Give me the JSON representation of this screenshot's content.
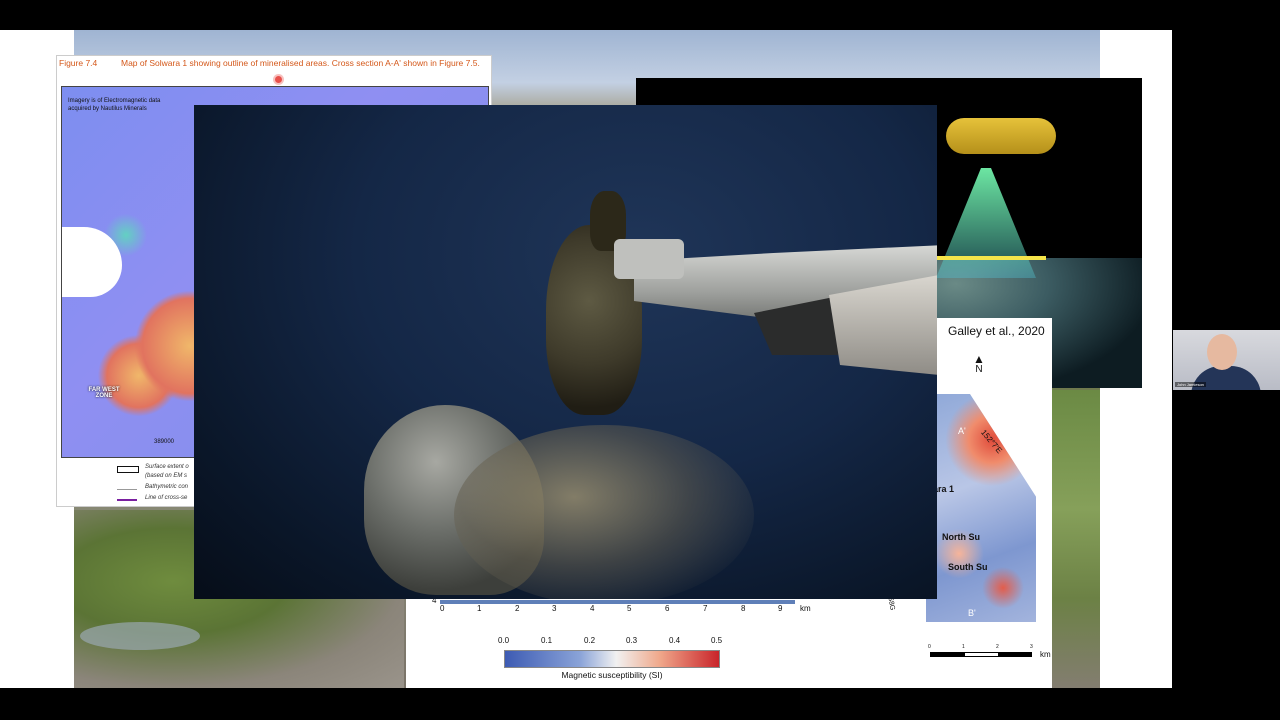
{
  "figure74": {
    "number": "Figure 7.4",
    "caption": "Map of Solwara 1 showing outline of mineralised areas. Cross section A-A' shown in Figure 7.5.",
    "imagery_note": "Imagery is of Electromagnetic data acquired by Nautilus Minerals",
    "zone_label": "FAR WEST ZONE",
    "easting": "389000",
    "legend": [
      {
        "label": "Surface extent o",
        "sub": "(based on EM s"
      },
      {
        "label": "Bathymetric con"
      },
      {
        "label": "Line of cross-se"
      }
    ]
  },
  "galley": {
    "citation": "Galley et al., 2020",
    "north": "N",
    "coordinate": "152°7'E",
    "places": [
      "wara 1",
      "North Su",
      "South Su"
    ],
    "section_labels": [
      "A'",
      "B'"
    ],
    "scale_ticks": [
      "0",
      "1",
      "2",
      "3"
    ],
    "scale_unit": "km",
    "side_label": "S8G"
  },
  "km_axis": {
    "ticks": [
      "0",
      "1",
      "2",
      "3",
      "4",
      "5",
      "6",
      "7",
      "8",
      "9"
    ],
    "unit": "km",
    "left_label": "4"
  },
  "colorbar": {
    "ticks": [
      "0.0",
      "0.1",
      "0.2",
      "0.3",
      "0.4",
      "0.5"
    ],
    "label": "Magnetic susceptibility (SI)"
  },
  "webcam": {
    "name": "John Jamieson"
  }
}
